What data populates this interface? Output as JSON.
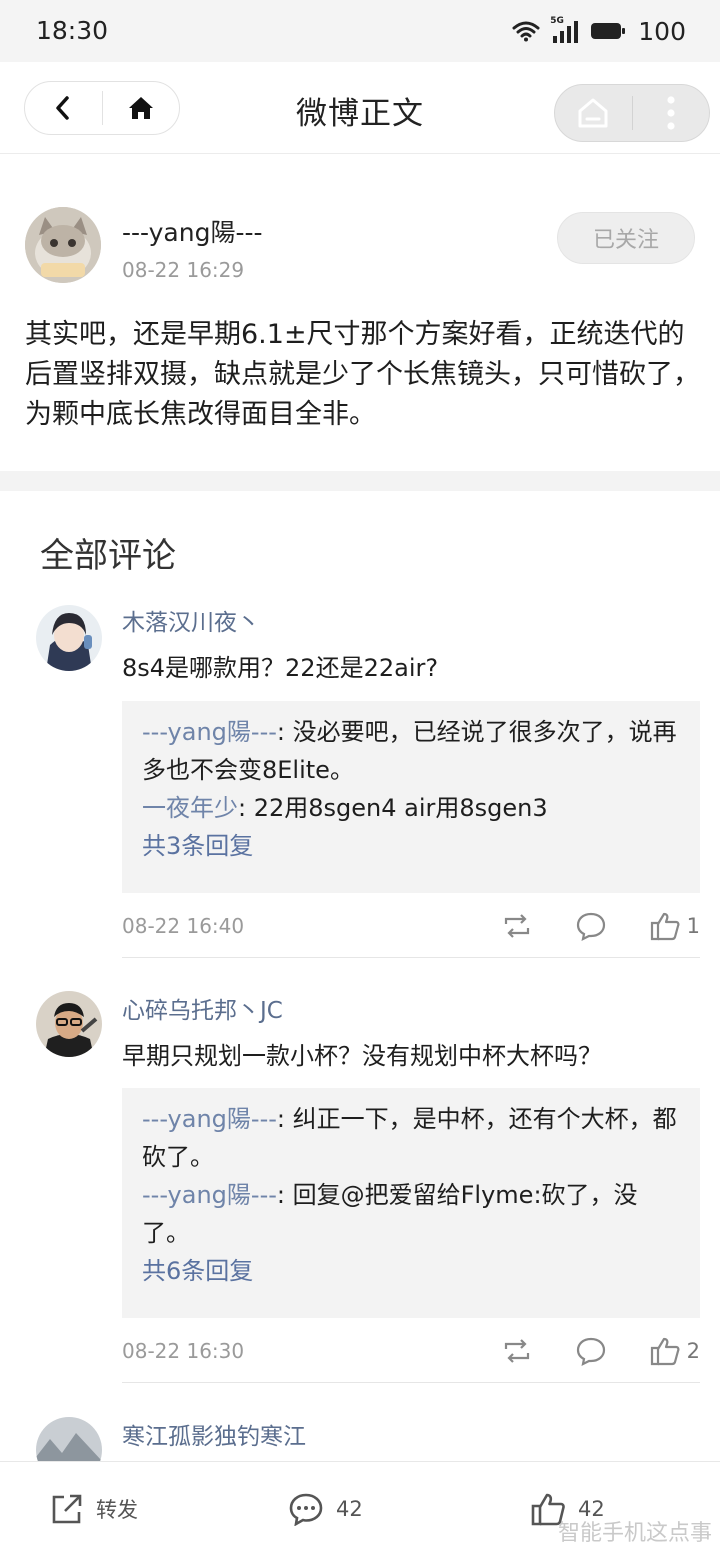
{
  "status_bar": {
    "time": "18:30",
    "network": "5G",
    "battery": "100"
  },
  "header": {
    "title": "微博正文"
  },
  "post": {
    "author": "---yang陽---",
    "time": "08-22 16:29",
    "follow_label": "已关注",
    "text": "其实吧，还是早期6.1±尺寸那个方案好看，正统迭代的后置竖排双摄，缺点就是少了个长焦镜头，只可惜砍了，为颗中底长焦改得面目全非。"
  },
  "comments_title": "全部评论",
  "comments": [
    {
      "user": "木落汉川夜丶",
      "text": "8s4是哪款用？22还是22air?",
      "replies": [
        {
          "user": "---yang陽---",
          "text": ": 没必要吧，已经说了很多次了，说再多也不会变8Elite。"
        },
        {
          "user": "一夜年少",
          "text": ": 22用8sgen4 air用8sgen3"
        }
      ],
      "more": "共3条回复",
      "time": "08-22 16:40",
      "likes": "1"
    },
    {
      "user": "心碎乌托邦丶JC",
      "text": "早期只规划一款小杯？没有规划中杯大杯吗？",
      "replies": [
        {
          "user": "---yang陽---",
          "text": ": 纠正一下，是中杯，还有个大杯，都砍了。"
        },
        {
          "user": "---yang陽---",
          "text": ": 回复@把爱留给Flyme:砍了，没了。"
        }
      ],
      "more": "共6条回复",
      "time": "08-22 16:30",
      "likes": "2"
    },
    {
      "user": "寒江孤影独钓寒江"
    }
  ],
  "bottom_bar": {
    "repost_label": "转发",
    "comment_count": "42",
    "like_count": "42"
  },
  "watermark": "智能手机这点事",
  "colors": {
    "username": "#5b6e8e",
    "reply_user": "#6f84a9",
    "link": "#5a72a0",
    "muted": "#9a9a9a"
  }
}
